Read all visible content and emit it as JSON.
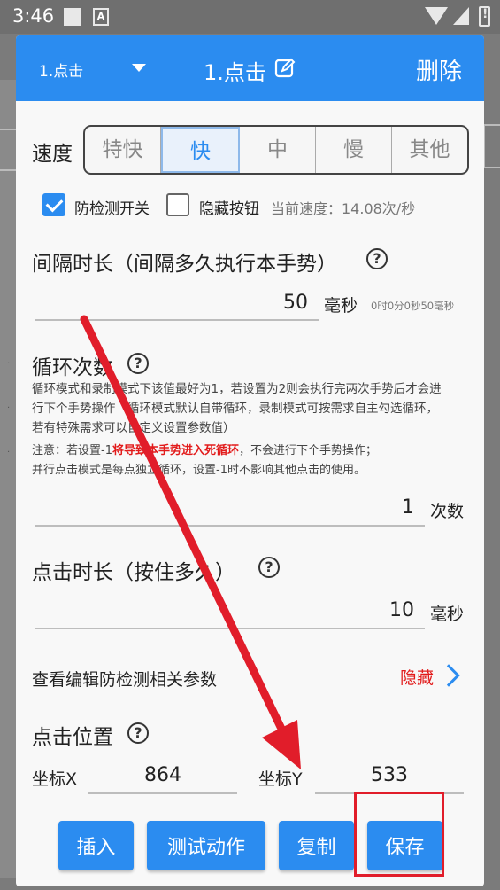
{
  "status_bar": {
    "time": "3:46"
  },
  "header": {
    "spinner_value": "1.点击",
    "title": "1.点击",
    "delete_label": "删除"
  },
  "speed": {
    "label": "速度",
    "options": [
      "特快",
      "快",
      "中",
      "慢",
      "其他"
    ],
    "selected": "快"
  },
  "options_row": {
    "anti_detect_label": "防检测开关",
    "anti_detect_checked": true,
    "hide_button_label": "隐藏按钮",
    "hide_button_checked": false,
    "current_speed": "当前速度：14.08次/秒"
  },
  "interval": {
    "title": "间隔时长（间隔多久执行本手势）",
    "value": "50",
    "unit": "毫秒",
    "detail": "0时0分0秒50毫秒"
  },
  "loop": {
    "title": "循环次数",
    "desc_line1": "循环模式和录制模式下该值最好为1，若设置为2则会执行完两次手势后才会进",
    "desc_line2": "行下个手势操作（循环模式默认自带循环，录制模式可按需求自主勾选循环，",
    "desc_line3": "若有特殊需求可以自定义设置参数值）",
    "note_prefix": "注意：若设置-1",
    "note_red": "将导致本手势进入死循环",
    "note_suffix": "，不会进行下个手势操作；",
    "note_line2": "并行点击模式是每点独立循环，设置-1时不影响其他点击的使用。",
    "value": "1",
    "unit": "次数"
  },
  "duration": {
    "title": "点击时长（按住多久）",
    "value": "10",
    "unit": "毫秒"
  },
  "anti_detect_params": {
    "label": "查看编辑防检测相关参数",
    "toggle_label": "隐藏"
  },
  "position": {
    "title": "点击位置",
    "x_label": "坐标X",
    "x_value": "864",
    "y_label": "坐标Y",
    "y_value": "533"
  },
  "buttons": {
    "insert": "插入",
    "test": "测试动作",
    "copy": "复制",
    "save": "保存"
  },
  "colors": {
    "accent": "#2b8cf0",
    "warning": "#e21b1b",
    "annotation": "#e11d2a"
  }
}
